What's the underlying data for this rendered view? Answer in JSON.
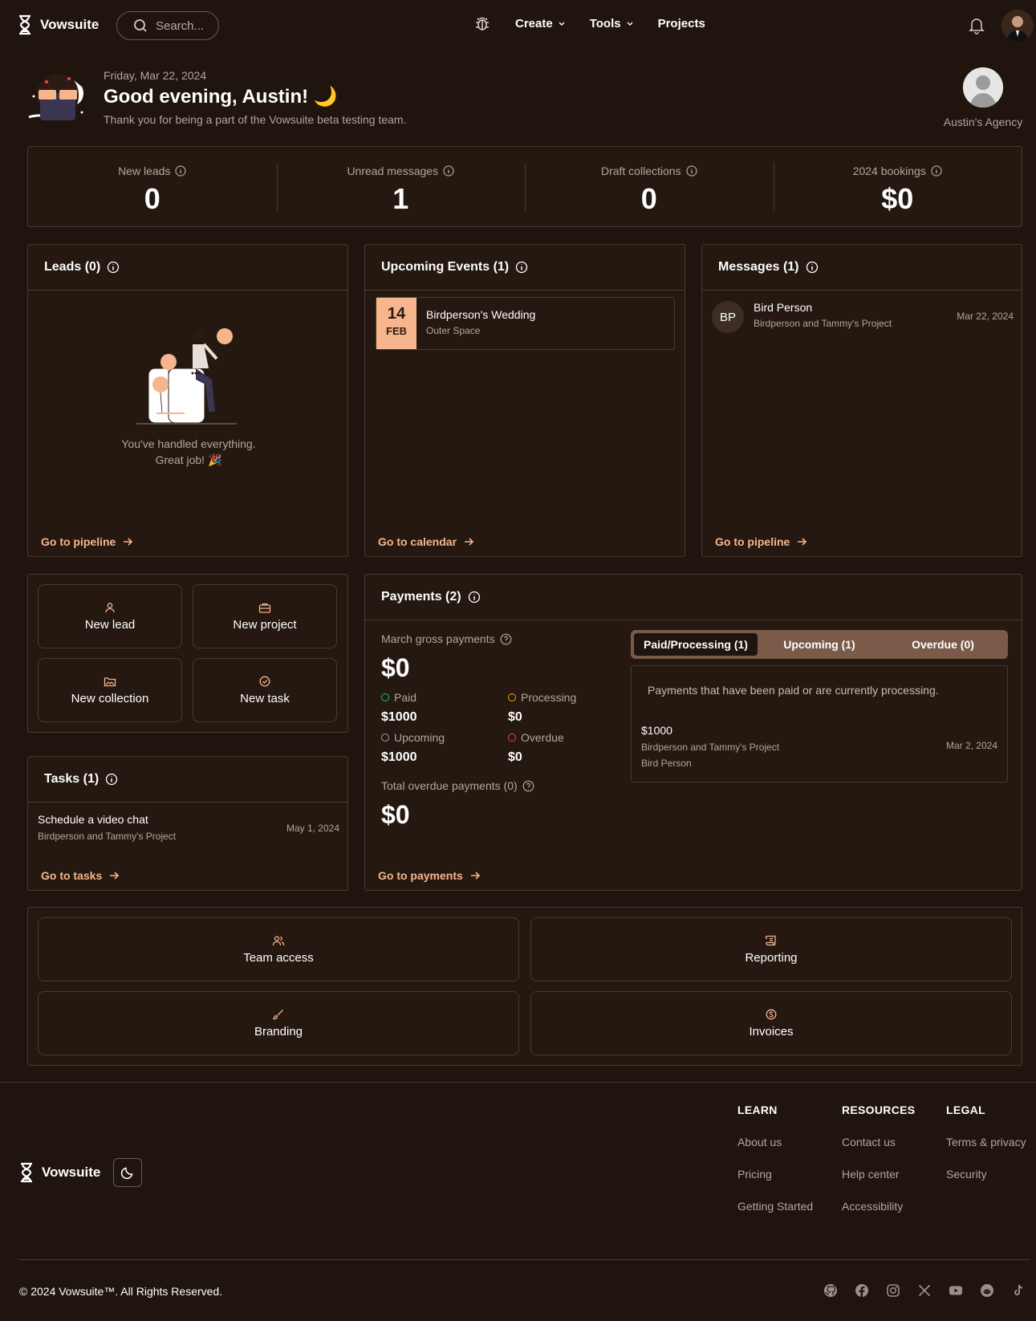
{
  "nav": {
    "brand": "Vowsuite",
    "search_placeholder": "Search...",
    "create_label": "Create",
    "tools_label": "Tools",
    "projects_label": "Projects"
  },
  "greeting": {
    "date": "Friday, Mar 22, 2024",
    "title": "Good evening, Austin! 🌙",
    "subtitle": "Thank you for being a part of the Vowsuite beta testing team.",
    "agency": "Austin's Agency"
  },
  "stats": [
    {
      "label": "New leads",
      "value": "0"
    },
    {
      "label": "Unread messages",
      "value": "1"
    },
    {
      "label": "Draft collections",
      "value": "0"
    },
    {
      "label": "2024 bookings",
      "value": "$0"
    }
  ],
  "leads": {
    "title": "Leads (0)",
    "empty_line1": "You've handled everything.",
    "empty_line2": "Great job! 🎉",
    "link": "Go to pipeline"
  },
  "events": {
    "title": "Upcoming Events (1)",
    "items": [
      {
        "day": "14",
        "month": "FEB",
        "name": "Birdperson's Wedding",
        "location": "Outer Space"
      }
    ],
    "link": "Go to calendar"
  },
  "messages": {
    "title": "Messages (1)",
    "items": [
      {
        "initials": "BP",
        "name": "Bird Person",
        "project": "Birdperson and Tammy's Project",
        "date": "Mar 22, 2024"
      }
    ],
    "link": "Go to pipeline"
  },
  "quick_actions": {
    "new_lead": "New lead",
    "new_project": "New project",
    "new_collection": "New collection",
    "new_task": "New task"
  },
  "tasks": {
    "title": "Tasks (1)",
    "items": [
      {
        "title": "Schedule a video chat",
        "project": "Birdperson and Tammy's Project",
        "date": "May 1, 2024"
      }
    ],
    "link": "Go to tasks"
  },
  "payments": {
    "title": "Payments (2)",
    "gross_label": "March gross payments",
    "gross_value": "$0",
    "paid_label": "Paid",
    "paid_value": "$1000",
    "processing_label": "Processing",
    "processing_value": "$0",
    "upcoming_label": "Upcoming",
    "upcoming_value": "$1000",
    "overdue_label": "Overdue",
    "overdue_value": "$0",
    "total_overdue_label": "Total overdue payments (0)",
    "total_overdue_value": "$0",
    "tabs": [
      "Paid/Processing (1)",
      "Upcoming (1)",
      "Overdue (0)"
    ],
    "panel_desc": "Payments that have been paid or are currently processing.",
    "items": [
      {
        "amount": "$1000",
        "project": "Birdperson and Tammy's Project",
        "client": "Bird Person",
        "date": "Mar 2, 2024"
      }
    ],
    "link": "Go to payments",
    "colors": {
      "paid": "#22c55e",
      "processing": "#f59e0b",
      "upcoming": "#9ca3af",
      "overdue": "#ef4444"
    }
  },
  "tools": {
    "team_access": "Team access",
    "reporting": "Reporting",
    "branding": "Branding",
    "invoices": "Invoices"
  },
  "footer": {
    "brand": "Vowsuite",
    "learn": {
      "head": "LEARN",
      "links": [
        "About us",
        "Pricing",
        "Getting Started"
      ]
    },
    "resources": {
      "head": "RESOURCES",
      "links": [
        "Contact us",
        "Help center",
        "Accessibility"
      ]
    },
    "legal": {
      "head": "LEGAL",
      "links": [
        "Terms & privacy",
        "Security"
      ]
    },
    "copyright": "© 2024 Vowsuite™. All Rights Reserved.",
    "social_icons": [
      "github-icon",
      "facebook-icon",
      "instagram-icon",
      "x-icon",
      "youtube-icon",
      "reddit-icon",
      "tiktok-icon"
    ]
  },
  "theme": {
    "accent": "#f7b58d",
    "background": "#1f140e",
    "card": "#241811",
    "border": "#4a3a30"
  }
}
